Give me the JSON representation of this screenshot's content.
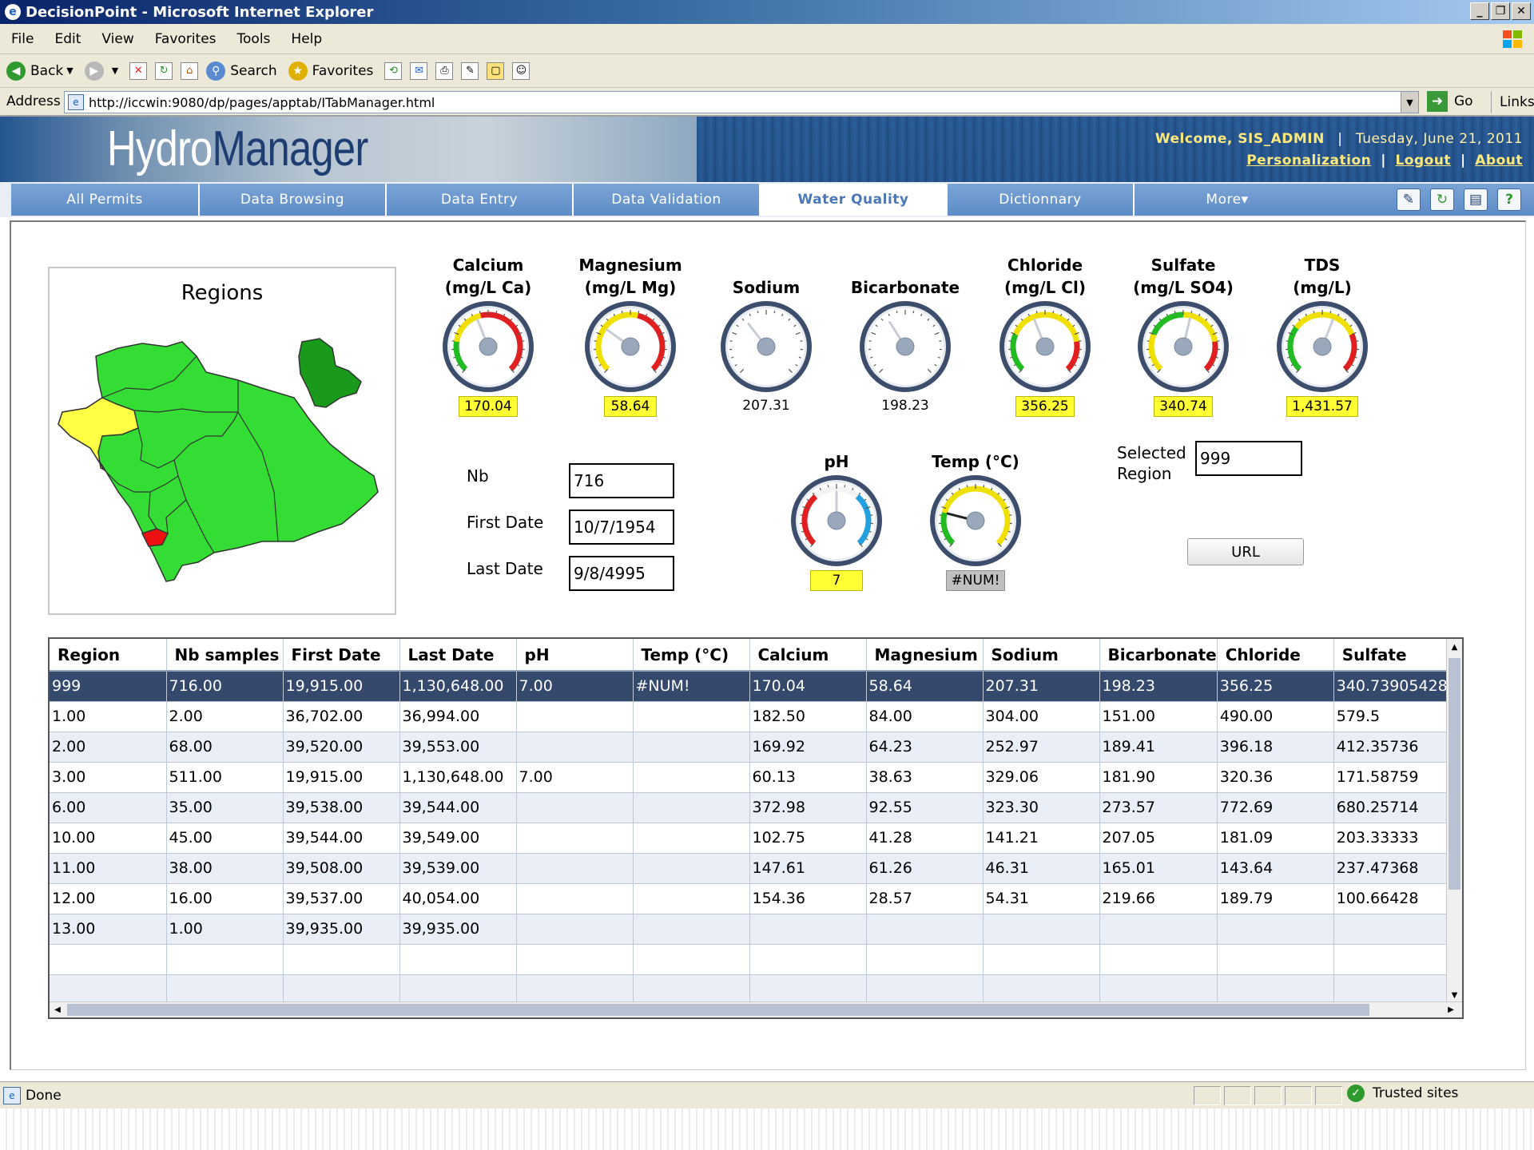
{
  "window": {
    "title": "DecisionPoint - Microsoft Internet Explorer"
  },
  "menu": [
    "File",
    "Edit",
    "View",
    "Favorites",
    "Tools",
    "Help"
  ],
  "toolbar": {
    "back": "Back",
    "search": "Search",
    "favorites": "Favorites"
  },
  "address": {
    "label": "Address",
    "url": "http://iccwin:9080/dp/pages/apptab/ITabManager.html",
    "go": "Go",
    "links": "Links"
  },
  "header": {
    "brand_part1": "Hydro",
    "brand_part2": "Manager",
    "welcome": "Welcome, SIS_ADMIN",
    "separator": "|",
    "date": "Tuesday, June 21, 2011",
    "links": [
      "Personalization",
      "Logout",
      "About"
    ]
  },
  "nav": {
    "tabs": [
      "All Permits",
      "Data Browsing",
      "Data Entry",
      "Data Validation",
      "Water Quality",
      "Dictionnary",
      "More▾"
    ],
    "active_index": 4
  },
  "regions": {
    "title": "Regions"
  },
  "gauges": [
    {
      "label": "Calcium\n(mg/L Ca)",
      "value": "170.04",
      "style": "yellow",
      "needle": 0.42
    },
    {
      "label": "Magnesium\n(mg/L Mg)",
      "value": "58.64",
      "style": "yellow",
      "needle": 0.3
    },
    {
      "label": "Sodium",
      "value": "207.31",
      "style": "plain",
      "needle": 0.36
    },
    {
      "label": "Bicarbonate",
      "value": "198.23",
      "style": "plain",
      "needle": 0.38
    },
    {
      "label": "Chloride\n(mg/L Cl)",
      "value": "356.25",
      "style": "yellow",
      "needle": 0.42
    },
    {
      "label": "Sulfate\n(mg/L SO4)",
      "value": "340.74",
      "style": "yellow",
      "needle": 0.55
    },
    {
      "label": "TDS\n(mg/L)",
      "value": "1,431.57",
      "style": "yellow",
      "needle": 0.58
    },
    {
      "label": "pH",
      "value": "7",
      "style": "yellow",
      "needle": 0.5
    },
    {
      "label": "Temp (°C)",
      "value": "#NUM!",
      "style": "grey",
      "needle": 0.22
    }
  ],
  "fields": {
    "nb_label": "Nb",
    "nb_value": "716",
    "first_label": "First Date",
    "first_value": "10/7/1954",
    "last_label": "Last Date",
    "last_value": "9/8/4995",
    "selected_region_label": "Selected\nRegion",
    "selected_region_value": "999",
    "url_button": "URL"
  },
  "table": {
    "columns": [
      "Region",
      "Nb samples",
      "First Date",
      "Last Date",
      "pH",
      "Temp (°C)",
      "Calcium",
      "Magnesium",
      "Sodium",
      "Bicarbonate",
      "Chloride",
      "Sulfate"
    ],
    "rows": [
      [
        "999",
        "716.00",
        "19,915.00",
        "1,130,648.00",
        "7.00",
        "#NUM!",
        "170.04",
        "58.64",
        "207.31",
        "198.23",
        "356.25",
        "340.73905428"
      ],
      [
        "1.00",
        "2.00",
        "36,702.00",
        "36,994.00",
        "",
        "",
        "182.50",
        "84.00",
        "304.00",
        "151.00",
        "490.00",
        "579.5"
      ],
      [
        "2.00",
        "68.00",
        "39,520.00",
        "39,553.00",
        "",
        "",
        "169.92",
        "64.23",
        "252.97",
        "189.41",
        "396.18",
        "412.35736"
      ],
      [
        "3.00",
        "511.00",
        "19,915.00",
        "1,130,648.00",
        "7.00",
        "",
        "60.13",
        "38.63",
        "329.06",
        "181.90",
        "320.36",
        "171.58759"
      ],
      [
        "6.00",
        "35.00",
        "39,538.00",
        "39,544.00",
        "",
        "",
        "372.98",
        "92.55",
        "323.30",
        "273.57",
        "772.69",
        "680.25714"
      ],
      [
        "10.00",
        "45.00",
        "39,544.00",
        "39,549.00",
        "",
        "",
        "102.75",
        "41.28",
        "141.21",
        "207.05",
        "181.09",
        "203.33333"
      ],
      [
        "11.00",
        "38.00",
        "39,508.00",
        "39,539.00",
        "",
        "",
        "147.61",
        "61.26",
        "46.31",
        "165.01",
        "143.64",
        "237.47368"
      ],
      [
        "12.00",
        "16.00",
        "39,537.00",
        "40,054.00",
        "",
        "",
        "154.36",
        "28.57",
        "54.31",
        "219.66",
        "189.79",
        "100.66428"
      ],
      [
        "13.00",
        "1.00",
        "39,935.00",
        "39,935.00",
        "",
        "",
        "",
        "",
        "",
        "",
        "",
        ""
      ],
      [
        "",
        "",
        "",
        "",
        "",
        "",
        "",
        "",
        "",
        "",
        "",
        ""
      ],
      [
        "",
        "",
        "",
        "",
        "",
        "",
        "",
        "",
        "",
        "",
        "",
        ""
      ]
    ]
  },
  "status": {
    "text": "Done",
    "zone": "Trusted sites"
  },
  "colors": {
    "nav": "#6f97cf",
    "selected_row": "#34496c",
    "region_green": "#33dd33",
    "region_yellow": "#ffff44",
    "region_red": "#ee1111",
    "region_dark": "#1a9a1a"
  }
}
